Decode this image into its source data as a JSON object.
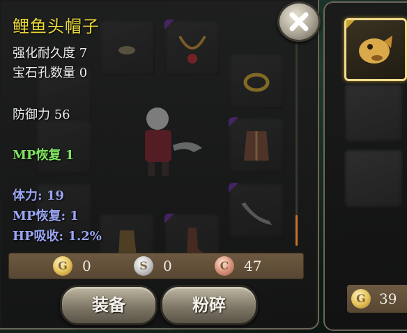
{
  "item": {
    "name": "鲤鱼头帽子",
    "durability": "强化耐久度 7",
    "gem_slots": "宝石孔数量 0",
    "defense": "防御力 56",
    "bonus_mp_regen": "MP恢复 1",
    "attrs": [
      "体力: 19",
      "MP恢复: 1",
      "HP吸收: 1.2%"
    ]
  },
  "currency": {
    "gold_symbol": "G",
    "gold": "0",
    "silver_symbol": "S",
    "silver": "0",
    "copper_symbol": "C",
    "copper": "47"
  },
  "buttons": {
    "equip": "装备",
    "smash": "粉碎"
  },
  "side_panel": {
    "gold_symbol": "G",
    "gold": "39"
  },
  "colors": {
    "title": "#e9d93a",
    "bonus_stat": "#7ee35f",
    "attr_stat": "#9aa6f4",
    "selection_border": "#f0dc8e"
  },
  "icons": {
    "close": "close-x-icon",
    "selected_item": "carp-head-hat-icon"
  }
}
